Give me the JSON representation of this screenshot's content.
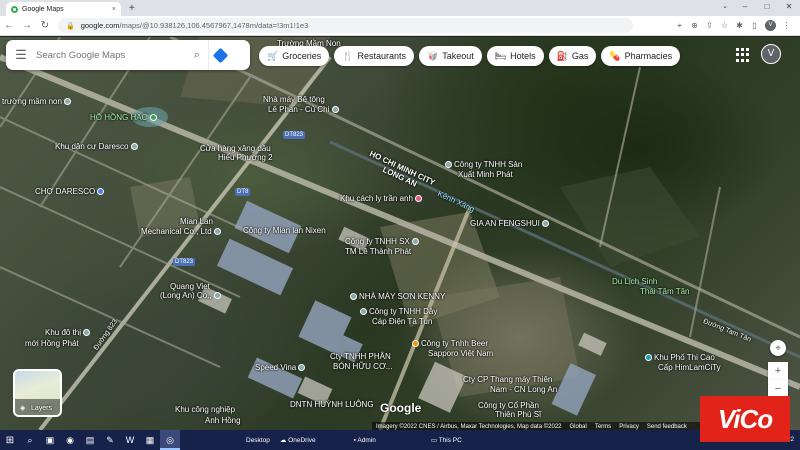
{
  "browser": {
    "tab_title": "Google Maps",
    "tab_close": "×",
    "new_tab": "+",
    "url_host": "google.com",
    "url_path": "/maps/@10.938126,106.4567967,1478m/data=!3m1!1e3",
    "window_controls": [
      "–",
      "□",
      "✕"
    ]
  },
  "search": {
    "placeholder": "Search Google Maps"
  },
  "chips": [
    {
      "icon": "🛒",
      "label": "Groceries"
    },
    {
      "icon": "🍴",
      "label": "Restaurants"
    },
    {
      "icon": "🥡",
      "label": "Takeout"
    },
    {
      "icon": "🛏",
      "label": "Hotels"
    },
    {
      "icon": "⛽",
      "label": "Gas"
    },
    {
      "icon": "💊",
      "label": "Pharmacies"
    }
  ],
  "account": {
    "initial": "V"
  },
  "map_labels": {
    "truong_mam_non_top": "Trường Mầm Non",
    "nha_may_be_tong": "Nhà máy Bê tông",
    "le_phan": "Lê Phan - Củ Chi",
    "truong_mam_non": "trường mầm non",
    "ho_hong_hac": "HỒ HỒNG HẠC",
    "dt823_1": "DT823",
    "khu_dan_cu": "Khu dân cư Daresco",
    "cua_hang": "Cửa hàng xăng dầu",
    "hieu_phuong": "Hiếu Phương 2",
    "ho_chi_minh_city": "HO CHI MINH CITY",
    "long_an": "LONG AN",
    "cong_ty_san_xuat": "Công ty TNHH Sản",
    "xuat_minh_phat": "Xuất Minh Phát",
    "dt8": "DT8",
    "cho_daresco": "CHỢ DARESCO",
    "khu_cach_ly": "Khu cách ly trần anh",
    "kenh_xang": "Kênh Xáng",
    "mian_lan": "Mian Lan",
    "mechanical": "Mechanical Co., Ltd",
    "cong_ty_mian": "Công ty Mian lan Nixen",
    "gia_an": "GIA AN FENGSHUI",
    "cong_ty_sx": "Công ty TNHH SX",
    "tm_le": "TM Lê Thành Phát",
    "dt823_2": "DT823",
    "quang_viet": "Quang Viet",
    "long_an_co": "(Long An) Co.,",
    "du_lich": "Du Lịch Sinh",
    "thai_tam": "Thái Tâm Tân",
    "nha_may_son": "NHÀ MÁY SƠN KENNY",
    "cong_ty_day": "Công ty TNHH Dây",
    "cap_dien": "Cáp Điện Tà Tun",
    "duong_823": "Đường 823",
    "duong_tam_tan": "Đường Tam Tân",
    "khu_do_thi": "Khu đô thị",
    "moi_hong_phat": "mới Hồng Phát",
    "beer": "Công ty Tnhh Beer",
    "sapporo": "Sapporo Việt Nam",
    "khu_pho": "Khu Phố Thi Cao",
    "cap_him": "Cấp HimLamCiTy",
    "cty_tnhh": "Cty TNHH PHÂN",
    "bon_huu": "BÓN HỮU CƠ...",
    "speed_vina": "Speed Vina",
    "cty_cp_thang": "Cty CP Thang máy Thiên",
    "nam_cn": "Nam - CN Long An",
    "dntn": "DNTN HUỲNH LUÔNG",
    "cong_ty_co_phan": "Công ty Cổ Phần",
    "thien_phu": "Thiên Phú Sĩ",
    "khu_cong_nghiep": "Khu công nghiệp",
    "anh_hong": "Anh Hồng"
  },
  "layers": {
    "label": "Layers"
  },
  "controls": {
    "zoom_in": "+",
    "zoom_out": "−",
    "locate": "⌖"
  },
  "google_logo": "Google",
  "attribution": [
    "Imagery ©2022 CNES / Airbus, Maxar Technologies, Map data ©2022",
    "Global",
    "Terms",
    "Privacy",
    "Send feedback"
  ],
  "watermark": "ViCo",
  "taskbar": {
    "desktop": "Desktop",
    "onedrive": "OneDrive",
    "admin": "Admin",
    "this_pc": "This PC",
    "date": "4/25/2022"
  }
}
